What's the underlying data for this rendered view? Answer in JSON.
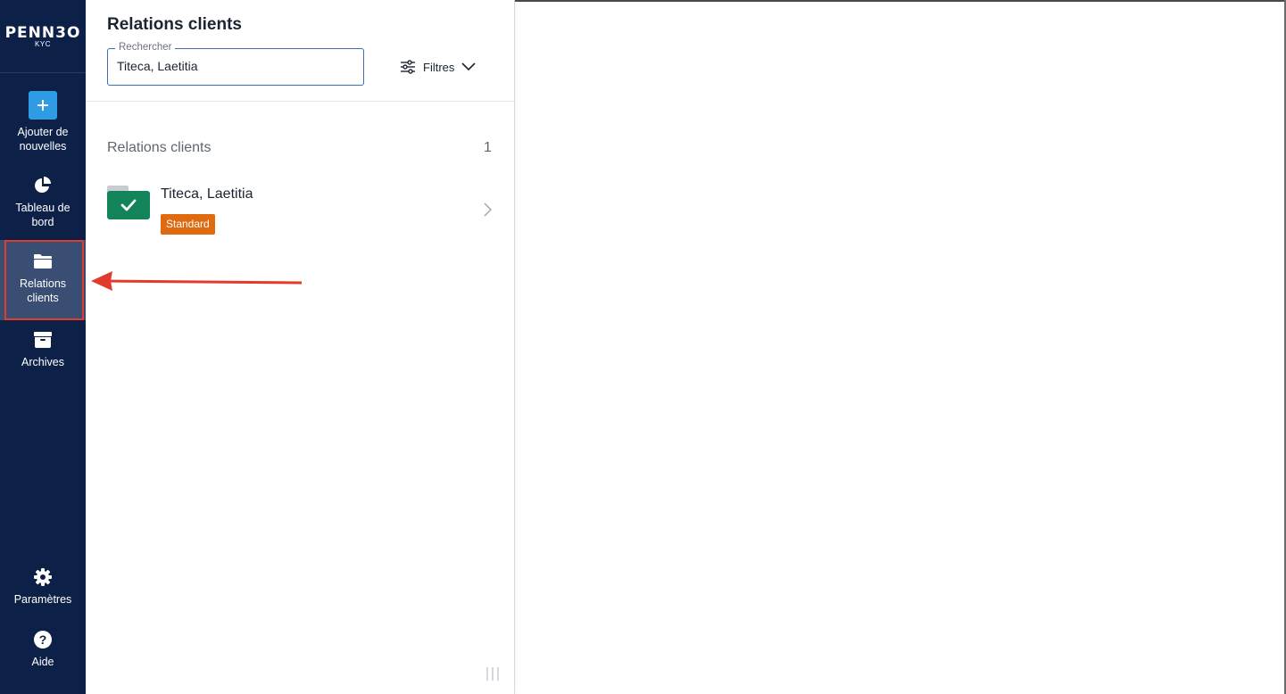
{
  "brand": {
    "name": "PENN3O",
    "sub": "KYC"
  },
  "sidebar": {
    "items": [
      {
        "label": "Ajouter de nouvelles",
        "icon": "plus-icon"
      },
      {
        "label": "Tableau de bord",
        "icon": "pie-chart-icon"
      },
      {
        "label": "Relations clients",
        "icon": "folder-icon",
        "active": true
      },
      {
        "label": "Archives",
        "icon": "archive-box-icon"
      },
      {
        "label": "Paramètres",
        "icon": "gear-icon"
      },
      {
        "label": "Aide",
        "icon": "help-icon"
      }
    ]
  },
  "panel": {
    "title": "Relations clients",
    "search": {
      "legend": "Rechercher",
      "value": "Titeca, Laetitia"
    },
    "filters_label": "Filtres",
    "section_title": "Relations clients",
    "count": "1",
    "clients": [
      {
        "name": "Titeca, Laetitia",
        "badge": "Standard",
        "status": "check-icon"
      }
    ]
  },
  "colors": {
    "sidebar_bg": "#0d2148",
    "accent_blue": "#2f9be3",
    "status_green": "#13845a",
    "badge_orange": "#df6a10",
    "annotation_red": "#e23b2e"
  }
}
